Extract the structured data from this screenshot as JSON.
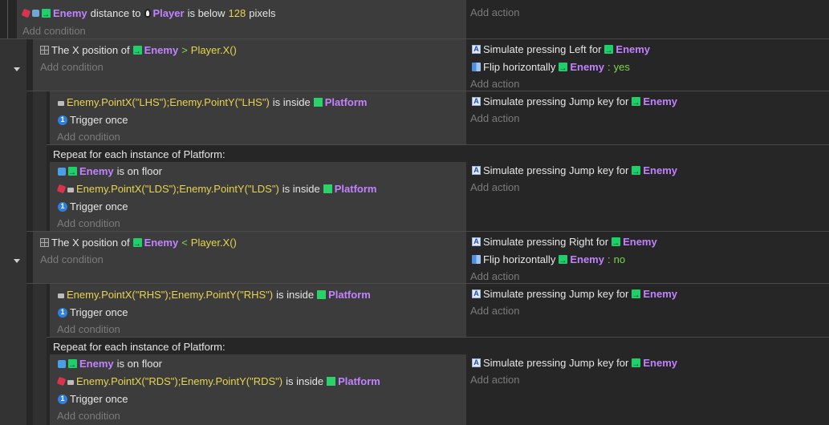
{
  "event1": {
    "cond": {
      "obj1": "Enemy",
      "t1": "distance to",
      "obj2": "Player",
      "t2": "is below",
      "val": "128",
      "t3": "pixels"
    },
    "add_condition": "Add condition",
    "add_action": "Add action"
  },
  "event2": {
    "cond": {
      "t1": "The X position of",
      "obj": "Enemy",
      "op": ">",
      "expr": "Player.X()"
    },
    "add_condition": "Add condition",
    "actions": [
      {
        "t": "Simulate pressing Left for",
        "obj": "Enemy"
      },
      {
        "t": "Flip horizontally",
        "obj": "Enemy",
        "sep": ":",
        "val": "yes"
      }
    ],
    "add_action": "Add action"
  },
  "event3": {
    "cond1": {
      "expr": "Enemy.PointX(\"LHS\");Enemy.PointY(\"LHS\")",
      "t": "is inside",
      "obj": "Platform"
    },
    "cond2": "Trigger once",
    "add_condition": "Add condition",
    "action": {
      "t": "Simulate pressing Jump key for",
      "obj": "Enemy"
    },
    "add_action": "Add action"
  },
  "event4": {
    "repeat": "Repeat for each instance of Platform:",
    "cond1": {
      "obj": "Enemy",
      "t": "is on floor"
    },
    "cond2": {
      "expr": "Enemy.PointX(\"LDS\");Enemy.PointY(\"LDS\")",
      "t": "is inside",
      "obj": "Platform"
    },
    "cond3": "Trigger once",
    "add_condition": "Add condition",
    "action": {
      "t": "Simulate pressing Jump key for",
      "obj": "Enemy"
    },
    "add_action": "Add action"
  },
  "event5": {
    "cond": {
      "t1": "The X position of",
      "obj": "Enemy",
      "op": "<",
      "expr": "Player.X()"
    },
    "add_condition": "Add condition",
    "actions": [
      {
        "t": "Simulate pressing Right for",
        "obj": "Enemy"
      },
      {
        "t": "Flip horizontally",
        "obj": "Enemy",
        "sep": ":",
        "val": "no"
      }
    ],
    "add_action": "Add action"
  },
  "event6": {
    "cond1": {
      "expr": "Enemy.PointX(\"RHS\");Enemy.PointY(\"RHS\")",
      "t": "is inside",
      "obj": "Platform"
    },
    "cond2": "Trigger once",
    "add_condition": "Add condition",
    "action": {
      "t": "Simulate pressing Jump key for",
      "obj": "Enemy"
    },
    "add_action": "Add action"
  },
  "event7": {
    "repeat": "Repeat for each instance of Platform:",
    "cond1": {
      "obj": "Enemy",
      "t": "is on floor"
    },
    "cond2": {
      "expr": "Enemy.PointX(\"RDS\");Enemy.PointY(\"RDS\")",
      "t": "is inside",
      "obj": "Platform"
    },
    "cond3": "Trigger once",
    "add_condition": "Add condition",
    "action": {
      "t": "Simulate pressing Jump key for",
      "obj": "Enemy"
    },
    "add_action": "Add action"
  },
  "icons": {
    "object": "object-icon",
    "distance": "distance-icon",
    "player": "player-icon",
    "grid": "position-icon",
    "keyboard": "keyboard-icon",
    "flip": "flip-icon",
    "point": "point-icon",
    "platform": "platform-icon",
    "trigger": "trigger-once-icon",
    "floor": "floor-icon",
    "collapse": "collapse-arrow-icon"
  }
}
